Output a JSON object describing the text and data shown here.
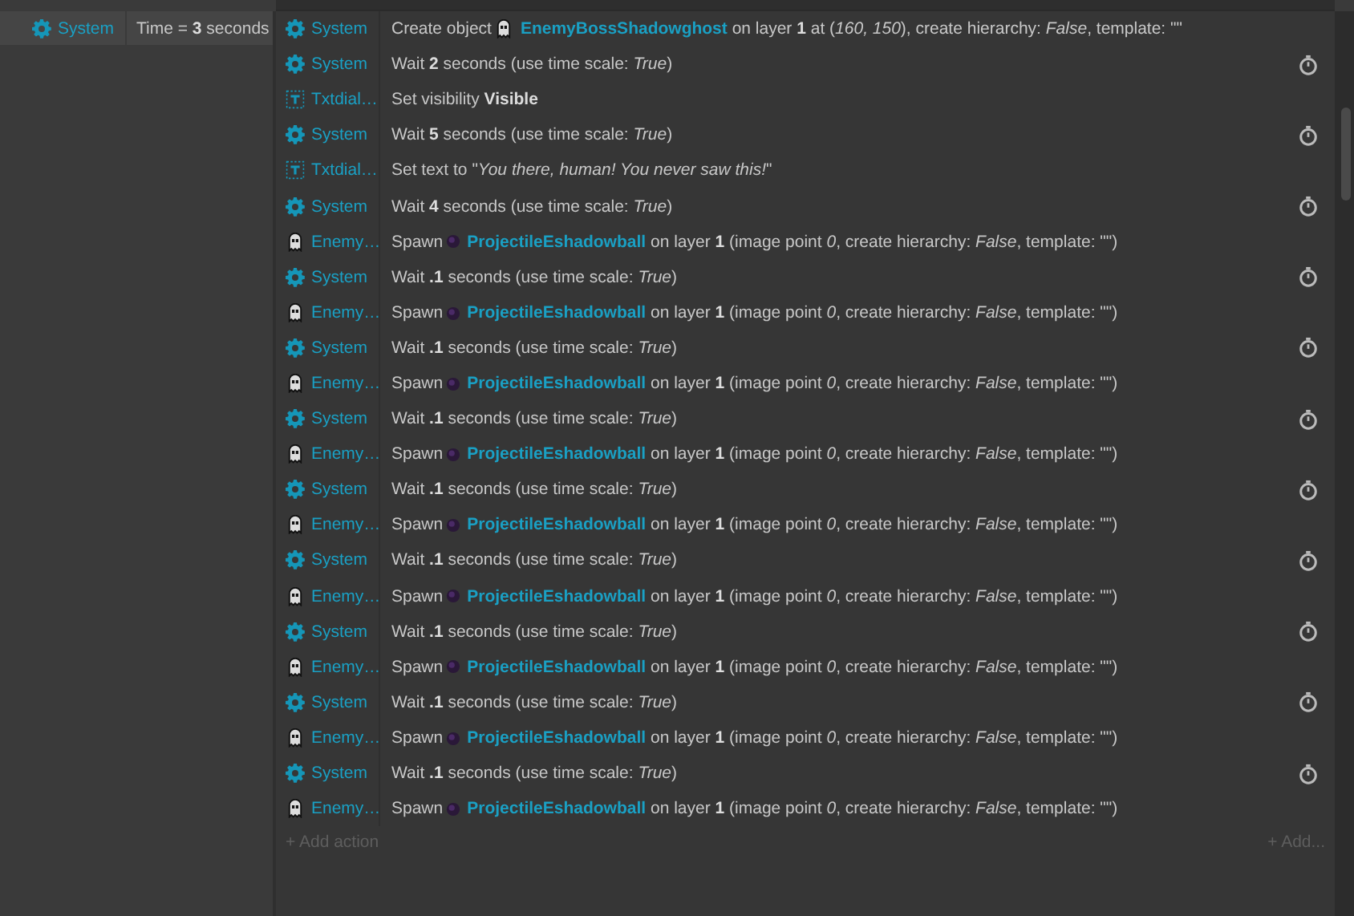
{
  "condition": {
    "object": {
      "kind": "system",
      "name": "System"
    },
    "text": "Time = **3** seconds"
  },
  "actions": [
    {
      "object": {
        "kind": "system",
        "name": "System"
      },
      "prefix": "Create object",
      "target": {
        "kind": "ghost",
        "name": "EnemyBossShadowghost"
      },
      "text": "on layer **1** at (*160, 150*), create hierarchy: *False*, template: \"\"",
      "timer": false
    },
    {
      "object": {
        "kind": "system",
        "name": "System"
      },
      "text": "Wait **2** seconds (use time scale: *True*)",
      "timer": true
    },
    {
      "object": {
        "kind": "text",
        "name": "Txtdial…"
      },
      "text": "Set visibility **Visible**",
      "timer": false
    },
    {
      "object": {
        "kind": "system",
        "name": "System"
      },
      "text": "Wait **5** seconds (use time scale: *True*)",
      "timer": true
    },
    {
      "object": {
        "kind": "text",
        "name": "Txtdial…"
      },
      "text": "Set text to \"*You there, human! You never saw this!*\"",
      "timer": false
    },
    {
      "object": {
        "kind": "system",
        "name": "System"
      },
      "text": "Wait **4** seconds (use time scale: *True*)",
      "timer": true
    },
    {
      "object": {
        "kind": "ghost",
        "name": "Enemy…"
      },
      "prefix": "Spawn",
      "target": {
        "kind": "ball",
        "name": "ProjectileEshadowball"
      },
      "text": "on layer **1** (image point *0*, create hierarchy: *False*, template: \"\")",
      "timer": false
    },
    {
      "object": {
        "kind": "system",
        "name": "System"
      },
      "text": "Wait **.1** seconds (use time scale: *True*)",
      "timer": true
    },
    {
      "object": {
        "kind": "ghost",
        "name": "Enemy…"
      },
      "prefix": "Spawn",
      "target": {
        "kind": "ball",
        "name": "ProjectileEshadowball"
      },
      "text": "on layer **1** (image point *0*, create hierarchy: *False*, template: \"\")",
      "timer": false
    },
    {
      "object": {
        "kind": "system",
        "name": "System"
      },
      "text": "Wait **.1** seconds (use time scale: *True*)",
      "timer": true
    },
    {
      "object": {
        "kind": "ghost",
        "name": "Enemy…"
      },
      "prefix": "Spawn",
      "target": {
        "kind": "ball",
        "name": "ProjectileEshadowball"
      },
      "text": "on layer **1** (image point *0*, create hierarchy: *False*, template: \"\")",
      "timer": false
    },
    {
      "object": {
        "kind": "system",
        "name": "System"
      },
      "text": "Wait **.1** seconds (use time scale: *True*)",
      "timer": true
    },
    {
      "object": {
        "kind": "ghost",
        "name": "Enemy…"
      },
      "prefix": "Spawn",
      "target": {
        "kind": "ball",
        "name": "ProjectileEshadowball"
      },
      "text": "on layer **1** (image point *0*, create hierarchy: *False*, template: \"\")",
      "timer": false
    },
    {
      "object": {
        "kind": "system",
        "name": "System"
      },
      "text": "Wait **.1** seconds (use time scale: *True*)",
      "timer": true
    },
    {
      "object": {
        "kind": "ghost",
        "name": "Enemy…"
      },
      "prefix": "Spawn",
      "target": {
        "kind": "ball",
        "name": "ProjectileEshadowball"
      },
      "text": "on layer **1** (image point *0*, create hierarchy: *False*, template: \"\")",
      "timer": false
    },
    {
      "object": {
        "kind": "system",
        "name": "System"
      },
      "text": "Wait **.1** seconds (use time scale: *True*)",
      "timer": true
    },
    {
      "object": {
        "kind": "ghost",
        "name": "Enemy…"
      },
      "prefix": "Spawn",
      "target": {
        "kind": "ball",
        "name": "ProjectileEshadowball"
      },
      "text": "on layer **1** (image point *0*, create hierarchy: *False*, template: \"\")",
      "timer": false
    },
    {
      "object": {
        "kind": "system",
        "name": "System"
      },
      "text": "Wait **.1** seconds (use time scale: *True*)",
      "timer": true
    },
    {
      "object": {
        "kind": "ghost",
        "name": "Enemy…"
      },
      "prefix": "Spawn",
      "target": {
        "kind": "ball",
        "name": "ProjectileEshadowball"
      },
      "text": "on layer **1** (image point *0*, create hierarchy: *False*, template: \"\")",
      "timer": false
    },
    {
      "object": {
        "kind": "system",
        "name": "System"
      },
      "text": "Wait **.1** seconds (use time scale: *True*)",
      "timer": true
    },
    {
      "object": {
        "kind": "ghost",
        "name": "Enemy…"
      },
      "prefix": "Spawn",
      "target": {
        "kind": "ball",
        "name": "ProjectileEshadowball"
      },
      "text": "on layer **1** (image point *0*, create hierarchy: *False*, template: \"\")",
      "timer": false
    },
    {
      "object": {
        "kind": "system",
        "name": "System"
      },
      "text": "Wait **.1** seconds (use time scale: *True*)",
      "timer": true
    },
    {
      "object": {
        "kind": "ghost",
        "name": "Enemy…"
      },
      "prefix": "Spawn",
      "target": {
        "kind": "ball",
        "name": "ProjectileEshadowball"
      },
      "text": "on layer **1** (image point *0*, create hierarchy: *False*, template: \"\")",
      "timer": false
    }
  ],
  "footer": {
    "add_action": "+ Add action",
    "add": "+ Add..."
  }
}
